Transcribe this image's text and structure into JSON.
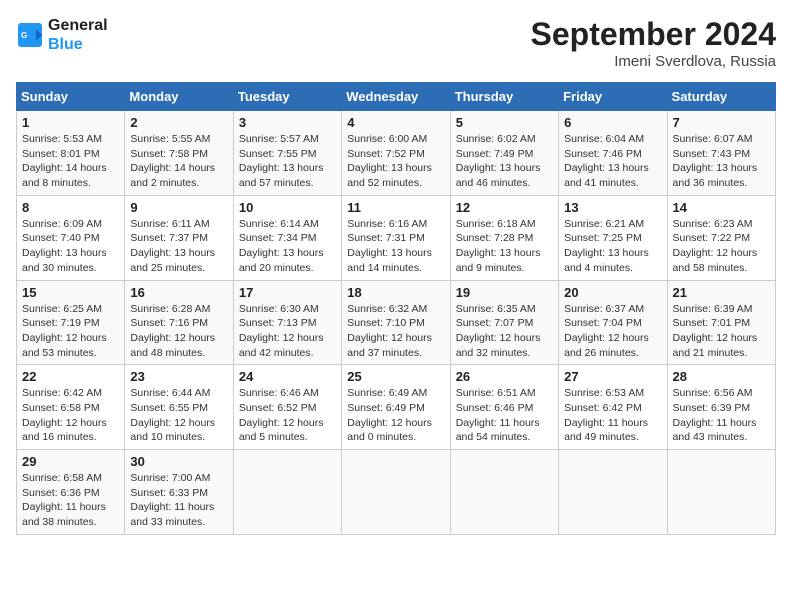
{
  "header": {
    "logo_line1": "General",
    "logo_line2": "Blue",
    "month": "September 2024",
    "location": "Imeni Sverdlova, Russia"
  },
  "days_of_week": [
    "Sunday",
    "Monday",
    "Tuesday",
    "Wednesday",
    "Thursday",
    "Friday",
    "Saturday"
  ],
  "weeks": [
    [
      {
        "day": "1",
        "lines": [
          "Sunrise: 5:53 AM",
          "Sunset: 8:01 PM",
          "Daylight: 14 hours",
          "and 8 minutes."
        ]
      },
      {
        "day": "2",
        "lines": [
          "Sunrise: 5:55 AM",
          "Sunset: 7:58 PM",
          "Daylight: 14 hours",
          "and 2 minutes."
        ]
      },
      {
        "day": "3",
        "lines": [
          "Sunrise: 5:57 AM",
          "Sunset: 7:55 PM",
          "Daylight: 13 hours",
          "and 57 minutes."
        ]
      },
      {
        "day": "4",
        "lines": [
          "Sunrise: 6:00 AM",
          "Sunset: 7:52 PM",
          "Daylight: 13 hours",
          "and 52 minutes."
        ]
      },
      {
        "day": "5",
        "lines": [
          "Sunrise: 6:02 AM",
          "Sunset: 7:49 PM",
          "Daylight: 13 hours",
          "and 46 minutes."
        ]
      },
      {
        "day": "6",
        "lines": [
          "Sunrise: 6:04 AM",
          "Sunset: 7:46 PM",
          "Daylight: 13 hours",
          "and 41 minutes."
        ]
      },
      {
        "day": "7",
        "lines": [
          "Sunrise: 6:07 AM",
          "Sunset: 7:43 PM",
          "Daylight: 13 hours",
          "and 36 minutes."
        ]
      }
    ],
    [
      {
        "day": "8",
        "lines": [
          "Sunrise: 6:09 AM",
          "Sunset: 7:40 PM",
          "Daylight: 13 hours",
          "and 30 minutes."
        ]
      },
      {
        "day": "9",
        "lines": [
          "Sunrise: 6:11 AM",
          "Sunset: 7:37 PM",
          "Daylight: 13 hours",
          "and 25 minutes."
        ]
      },
      {
        "day": "10",
        "lines": [
          "Sunrise: 6:14 AM",
          "Sunset: 7:34 PM",
          "Daylight: 13 hours",
          "and 20 minutes."
        ]
      },
      {
        "day": "11",
        "lines": [
          "Sunrise: 6:16 AM",
          "Sunset: 7:31 PM",
          "Daylight: 13 hours",
          "and 14 minutes."
        ]
      },
      {
        "day": "12",
        "lines": [
          "Sunrise: 6:18 AM",
          "Sunset: 7:28 PM",
          "Daylight: 13 hours",
          "and 9 minutes."
        ]
      },
      {
        "day": "13",
        "lines": [
          "Sunrise: 6:21 AM",
          "Sunset: 7:25 PM",
          "Daylight: 13 hours",
          "and 4 minutes."
        ]
      },
      {
        "day": "14",
        "lines": [
          "Sunrise: 6:23 AM",
          "Sunset: 7:22 PM",
          "Daylight: 12 hours",
          "and 58 minutes."
        ]
      }
    ],
    [
      {
        "day": "15",
        "lines": [
          "Sunrise: 6:25 AM",
          "Sunset: 7:19 PM",
          "Daylight: 12 hours",
          "and 53 minutes."
        ]
      },
      {
        "day": "16",
        "lines": [
          "Sunrise: 6:28 AM",
          "Sunset: 7:16 PM",
          "Daylight: 12 hours",
          "and 48 minutes."
        ]
      },
      {
        "day": "17",
        "lines": [
          "Sunrise: 6:30 AM",
          "Sunset: 7:13 PM",
          "Daylight: 12 hours",
          "and 42 minutes."
        ]
      },
      {
        "day": "18",
        "lines": [
          "Sunrise: 6:32 AM",
          "Sunset: 7:10 PM",
          "Daylight: 12 hours",
          "and 37 minutes."
        ]
      },
      {
        "day": "19",
        "lines": [
          "Sunrise: 6:35 AM",
          "Sunset: 7:07 PM",
          "Daylight: 12 hours",
          "and 32 minutes."
        ]
      },
      {
        "day": "20",
        "lines": [
          "Sunrise: 6:37 AM",
          "Sunset: 7:04 PM",
          "Daylight: 12 hours",
          "and 26 minutes."
        ]
      },
      {
        "day": "21",
        "lines": [
          "Sunrise: 6:39 AM",
          "Sunset: 7:01 PM",
          "Daylight: 12 hours",
          "and 21 minutes."
        ]
      }
    ],
    [
      {
        "day": "22",
        "lines": [
          "Sunrise: 6:42 AM",
          "Sunset: 6:58 PM",
          "Daylight: 12 hours",
          "and 16 minutes."
        ]
      },
      {
        "day": "23",
        "lines": [
          "Sunrise: 6:44 AM",
          "Sunset: 6:55 PM",
          "Daylight: 12 hours",
          "and 10 minutes."
        ]
      },
      {
        "day": "24",
        "lines": [
          "Sunrise: 6:46 AM",
          "Sunset: 6:52 PM",
          "Daylight: 12 hours",
          "and 5 minutes."
        ]
      },
      {
        "day": "25",
        "lines": [
          "Sunrise: 6:49 AM",
          "Sunset: 6:49 PM",
          "Daylight: 12 hours",
          "and 0 minutes."
        ]
      },
      {
        "day": "26",
        "lines": [
          "Sunrise: 6:51 AM",
          "Sunset: 6:46 PM",
          "Daylight: 11 hours",
          "and 54 minutes."
        ]
      },
      {
        "day": "27",
        "lines": [
          "Sunrise: 6:53 AM",
          "Sunset: 6:42 PM",
          "Daylight: 11 hours",
          "and 49 minutes."
        ]
      },
      {
        "day": "28",
        "lines": [
          "Sunrise: 6:56 AM",
          "Sunset: 6:39 PM",
          "Daylight: 11 hours",
          "and 43 minutes."
        ]
      }
    ],
    [
      {
        "day": "29",
        "lines": [
          "Sunrise: 6:58 AM",
          "Sunset: 6:36 PM",
          "Daylight: 11 hours",
          "and 38 minutes."
        ]
      },
      {
        "day": "30",
        "lines": [
          "Sunrise: 7:00 AM",
          "Sunset: 6:33 PM",
          "Daylight: 11 hours",
          "and 33 minutes."
        ]
      },
      null,
      null,
      null,
      null,
      null
    ]
  ]
}
